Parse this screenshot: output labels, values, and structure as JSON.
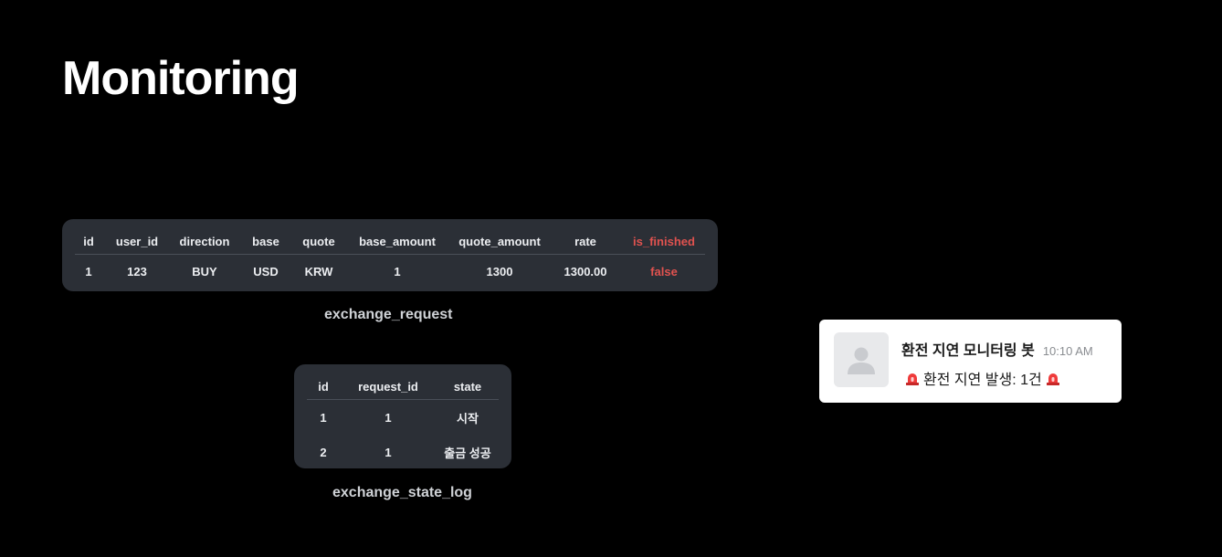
{
  "slide": {
    "title": "Monitoring"
  },
  "exchange_request": {
    "caption": "exchange_request",
    "columns": [
      "id",
      "user_id",
      "direction",
      "base",
      "quote",
      "base_amount",
      "quote_amount",
      "rate",
      "is_finished"
    ],
    "rows": [
      [
        "1",
        "123",
        "BUY",
        "USD",
        "KRW",
        "1",
        "1300",
        "1300.00",
        "false"
      ]
    ],
    "highlight_color": "#e0524f"
  },
  "exchange_state_log": {
    "caption": "exchange_state_log",
    "columns": [
      "id",
      "request_id",
      "state"
    ],
    "rows": [
      [
        "1",
        "1",
        "시작"
      ],
      [
        "2",
        "1",
        "출금 성공"
      ]
    ]
  },
  "notification": {
    "bot_name": "환전 지연 모니터링 봇",
    "time": "10:10 AM",
    "message": "환전 지연 발생: 1건",
    "icon": "siren-icon"
  }
}
